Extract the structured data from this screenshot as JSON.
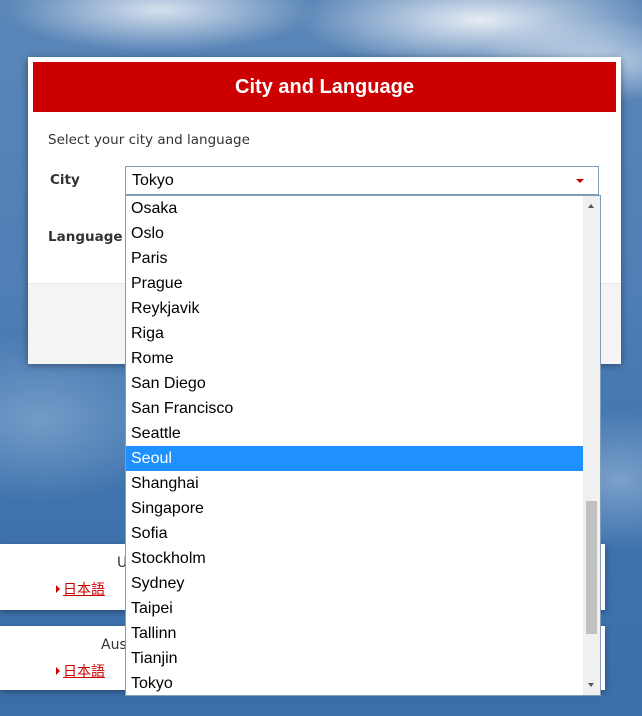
{
  "dialog": {
    "title": "City and Language",
    "instruction": "Select your city and language",
    "city_label": "City",
    "language_label": "Language",
    "city_value": "Tokyo"
  },
  "city_dropdown": {
    "options": [
      "Osaka",
      "Oslo",
      "Paris",
      "Prague",
      "Reykjavik",
      "Riga",
      "Rome",
      "San Diego",
      "San Francisco",
      "Seattle",
      "Seoul",
      "Shanghai",
      "Singapore",
      "Sofia",
      "Stockholm",
      "Sydney",
      "Taipei",
      "Tallinn",
      "Tianjin",
      "Tokyo"
    ],
    "highlighted": "Seoul"
  },
  "background_cards": [
    {
      "title_fragment": "U",
      "language_link": "日本語"
    },
    {
      "title_fragment": "Aus",
      "language_link": "日本語"
    }
  ],
  "colors": {
    "header_red": "#cc0000",
    "highlight_blue": "#1e90ff",
    "link_red": "#cc0000"
  },
  "icons": {
    "select_caret": "caret-down-icon",
    "scroll_up": "chevron-up-icon",
    "scroll_down": "chevron-down-icon",
    "link_arrow": "triangle-right-icon"
  }
}
